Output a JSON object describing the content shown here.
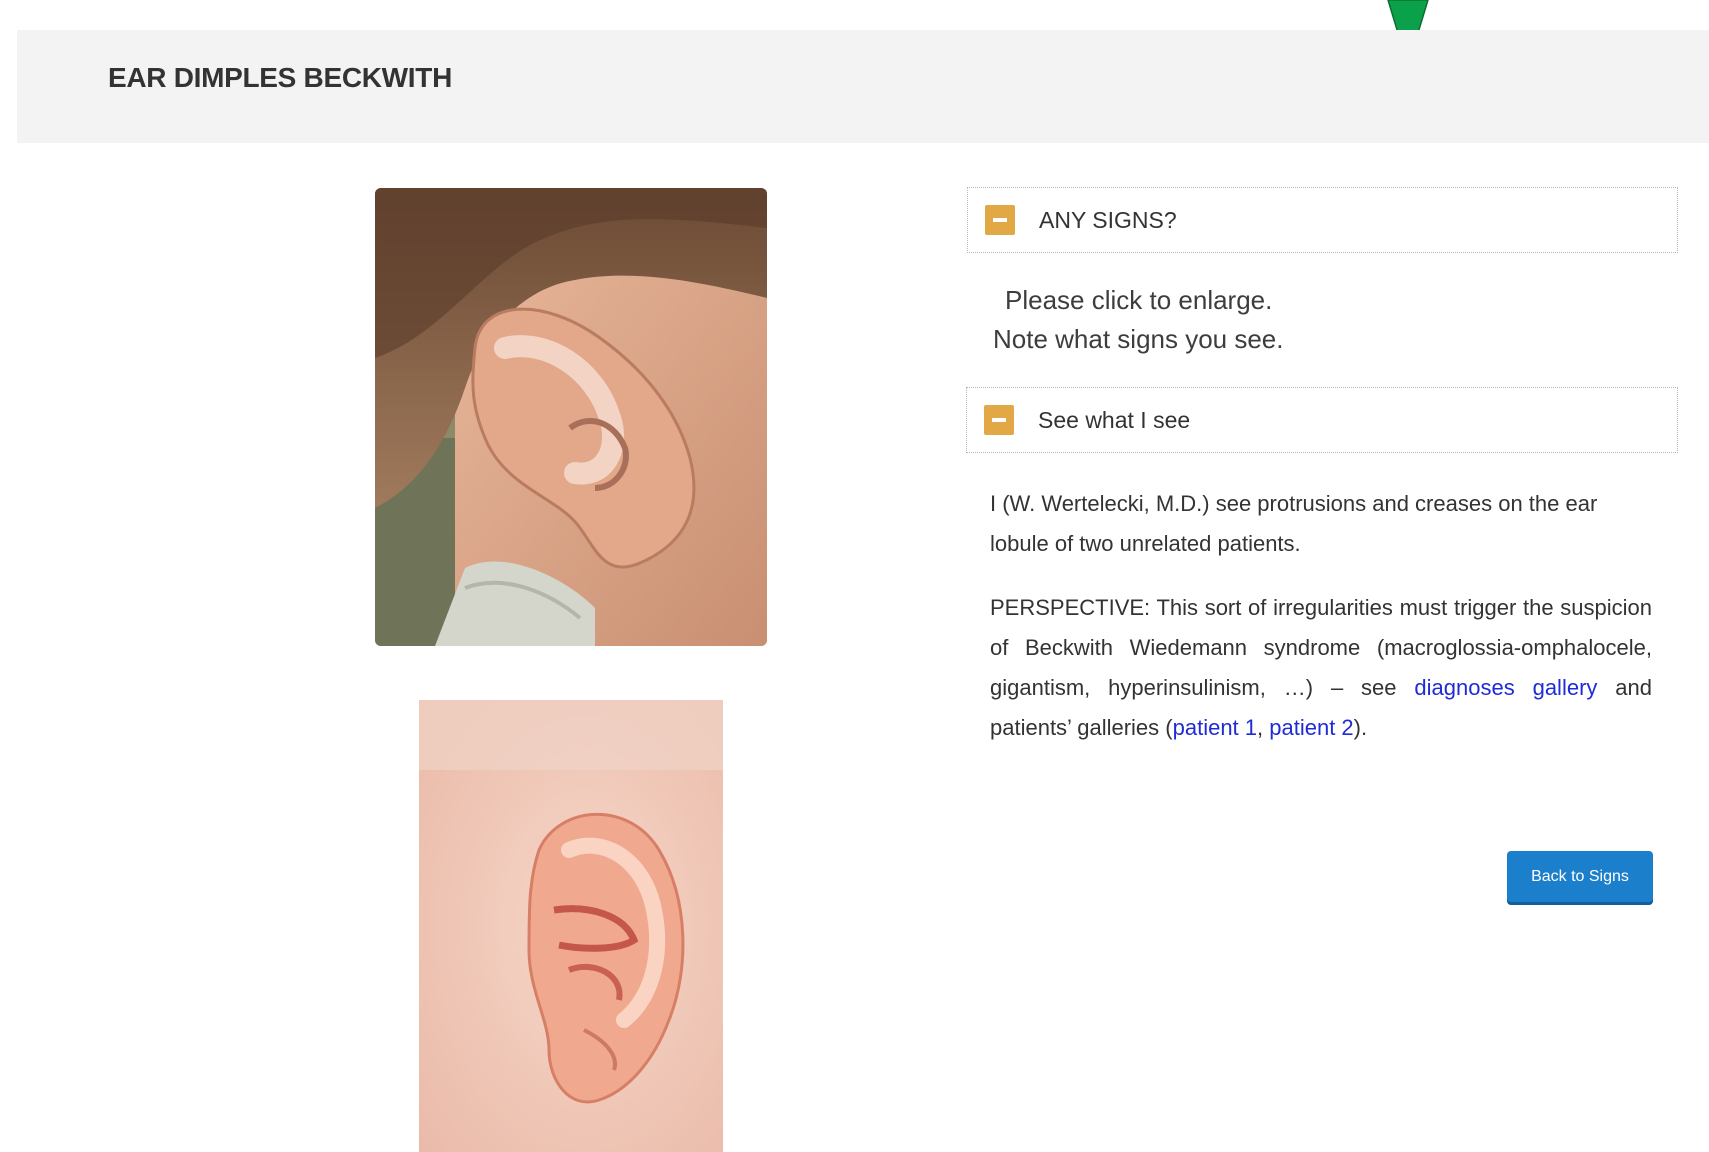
{
  "page": {
    "title": "EAR DIMPLES BECKWITH"
  },
  "accordion_any_signs": {
    "label": "ANY SIGNS?",
    "icon": "minus-icon",
    "prompt_line_1": "Please click to enlarge.",
    "prompt_line_2": "Note what signs you see."
  },
  "accordion_see_what": {
    "label": "See what I see",
    "icon": "minus-icon",
    "paragraph_1": "I (W. Wertelecki, M.D.) see protrusions and creases on the ear lobule of two unrelated patients.",
    "paragraph_2_prefix": "PERSPECTIVE: This sort of irregularities must trigger the suspicion of Beckwith Wiedemann syndrome (macroglossia-omphalocele, gigantism, hyperinsulinism, …) – see ",
    "link_diagnoses": "diagnoses gallery",
    "paragraph_2_middle": " and patients’ galleries (",
    "link_patient_1": "patient 1",
    "separator": ", ",
    "link_patient_2": "patient 2",
    "paragraph_2_suffix": ")."
  },
  "buttons": {
    "back_label": "Back to Signs"
  },
  "colors": {
    "accent_orange": "#e3a846",
    "button_blue": "#1c7fcb",
    "link_blue": "#1f2bd6",
    "marker_green": "#0aa14a"
  }
}
